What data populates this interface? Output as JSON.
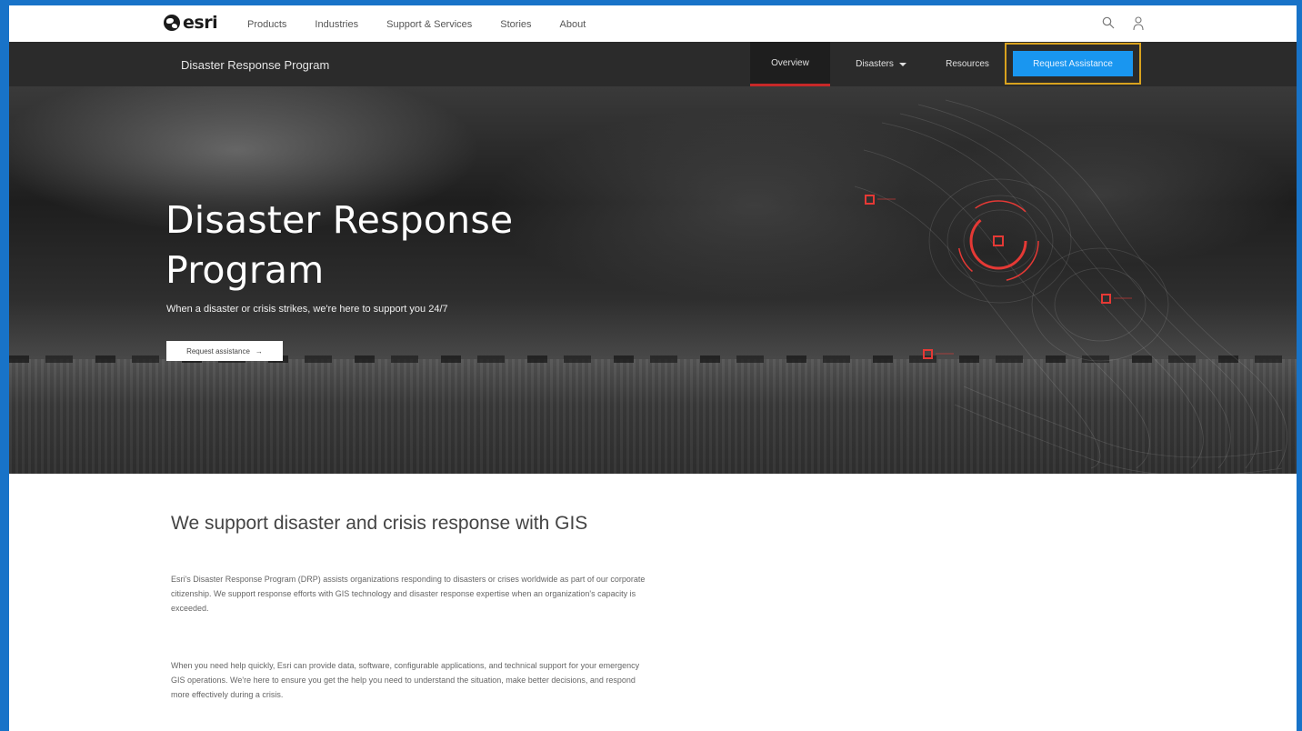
{
  "topnav": {
    "logo_text": "esri",
    "menu": [
      "Products",
      "Industries",
      "Support & Services",
      "Stories",
      "About"
    ]
  },
  "program_bar": {
    "title": "Disaster Response Program",
    "tabs": {
      "overview": "Overview",
      "disasters": "Disasters",
      "resources": "Resources"
    },
    "request_button": "Request Assistance"
  },
  "hero": {
    "title": "Disaster Response Program",
    "subtitle": "When a disaster or crisis strikes, we're here to support you 24/7",
    "button_label": "Request assistance",
    "button_arrow": "→"
  },
  "content": {
    "heading": "We support disaster and crisis response with GIS",
    "paragraph1": "Esri's Disaster Response Program (DRP) assists organizations responding to disasters or crises worldwide as part of our corporate citizenship. We support response efforts with GIS technology and disaster response expertise when an organization's capacity is exceeded.",
    "paragraph2": "When you need help quickly, Esri can provide data, software, configurable applications, and technical support for your emergency GIS operations. We're here to ensure you get the help you need to understand the situation, make better decisions, and respond more effectively during a crisis."
  },
  "colors": {
    "accent_blue": "#1996f0",
    "focus_outline": "#d9a21e",
    "active_tab_underline": "#c62828",
    "map_marker_red": "#e53935",
    "frame_blue": "#1873c8"
  },
  "icons": [
    "globe-logo-icon",
    "search-icon",
    "user-icon",
    "chevron-down-icon",
    "arrow-right-icon",
    "map-marker-icon"
  ]
}
